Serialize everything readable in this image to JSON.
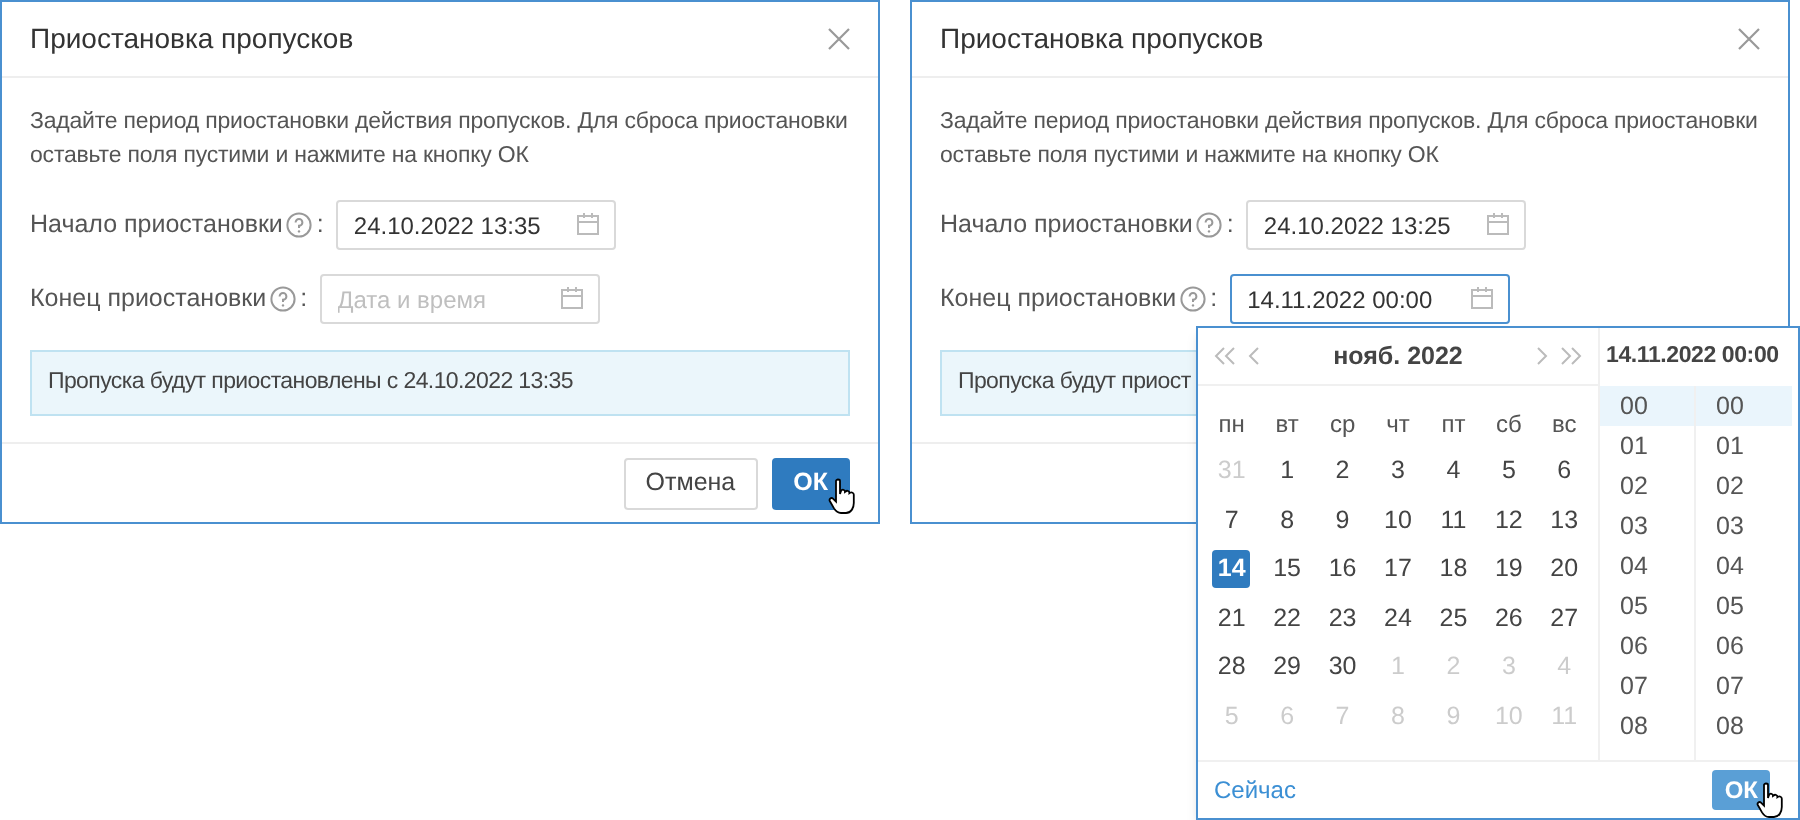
{
  "dialogs": [
    {
      "title": "Приостановка пропусков",
      "description": "Задайте период приостановки действия пропусков. Для сброса приостановки оставьте поля пустими и нажмите на кнопку ОК",
      "fields": [
        {
          "label": "Начало приостановки",
          "suffix": ":",
          "value": "24.10.2022 13:35",
          "focused": false
        },
        {
          "label": "Конец приостановки",
          "suffix": ":",
          "placeholder": "Дата и время",
          "focused": false
        }
      ],
      "info": "Пропуска будут приостановлены с 24.10.2022 13:35",
      "buttons": [
        {
          "label": "Отмена",
          "kind": "secondary"
        },
        {
          "label": "ОК",
          "kind": "primary"
        }
      ]
    },
    {
      "title": "Приостановка пропусков",
      "description": "Задайте период приостановки действия пропусков. Для сброса приостановки оставьте поля пустими и нажмите на кнопку ОК",
      "fields": [
        {
          "label": "Начало приостановки",
          "suffix": ":",
          "value": "24.10.2022 13:25",
          "focused": false
        },
        {
          "label": "Конец приостановки",
          "suffix": ":",
          "value": "14.11.2022 00:00",
          "focused": true
        }
      ],
      "info": "Пропуска будут приост"
    }
  ],
  "picker": {
    "month_label": "нояб. 2022",
    "weekdays": [
      "пн",
      "вт",
      "ср",
      "чт",
      "пт",
      "сб",
      "вс"
    ],
    "days": [
      {
        "label": "31",
        "muted": true,
        "selected": false
      },
      {
        "label": "1",
        "muted": false,
        "selected": false
      },
      {
        "label": "2",
        "muted": false,
        "selected": false
      },
      {
        "label": "3",
        "muted": false,
        "selected": false
      },
      {
        "label": "4",
        "muted": false,
        "selected": false
      },
      {
        "label": "5",
        "muted": false,
        "selected": false
      },
      {
        "label": "6",
        "muted": false,
        "selected": false
      },
      {
        "label": "7",
        "muted": false,
        "selected": false
      },
      {
        "label": "8",
        "muted": false,
        "selected": false
      },
      {
        "label": "9",
        "muted": false,
        "selected": false
      },
      {
        "label": "10",
        "muted": false,
        "selected": false
      },
      {
        "label": "11",
        "muted": false,
        "selected": false
      },
      {
        "label": "12",
        "muted": false,
        "selected": false
      },
      {
        "label": "13",
        "muted": false,
        "selected": false
      },
      {
        "label": "14",
        "muted": false,
        "selected": true
      },
      {
        "label": "15",
        "muted": false,
        "selected": false
      },
      {
        "label": "16",
        "muted": false,
        "selected": false
      },
      {
        "label": "17",
        "muted": false,
        "selected": false
      },
      {
        "label": "18",
        "muted": false,
        "selected": false
      },
      {
        "label": "19",
        "muted": false,
        "selected": false
      },
      {
        "label": "20",
        "muted": false,
        "selected": false
      },
      {
        "label": "21",
        "muted": false,
        "selected": false
      },
      {
        "label": "22",
        "muted": false,
        "selected": false
      },
      {
        "label": "23",
        "muted": false,
        "selected": false
      },
      {
        "label": "24",
        "muted": false,
        "selected": false
      },
      {
        "label": "25",
        "muted": false,
        "selected": false
      },
      {
        "label": "26",
        "muted": false,
        "selected": false
      },
      {
        "label": "27",
        "muted": false,
        "selected": false
      },
      {
        "label": "28",
        "muted": false,
        "selected": false
      },
      {
        "label": "29",
        "muted": false,
        "selected": false
      },
      {
        "label": "30",
        "muted": false,
        "selected": false
      },
      {
        "label": "1",
        "muted": true,
        "selected": false
      },
      {
        "label": "2",
        "muted": true,
        "selected": false
      },
      {
        "label": "3",
        "muted": true,
        "selected": false
      },
      {
        "label": "4",
        "muted": true,
        "selected": false
      },
      {
        "label": "5",
        "muted": true,
        "selected": false
      },
      {
        "label": "6",
        "muted": true,
        "selected": false
      },
      {
        "label": "7",
        "muted": true,
        "selected": false
      },
      {
        "label": "8",
        "muted": true,
        "selected": false
      },
      {
        "label": "9",
        "muted": true,
        "selected": false
      },
      {
        "label": "10",
        "muted": true,
        "selected": false
      },
      {
        "label": "11",
        "muted": true,
        "selected": false
      }
    ],
    "time_header": "14.11.2022 00:00",
    "hours": [
      {
        "label": "00",
        "selected": true
      },
      {
        "label": "01",
        "selected": false
      },
      {
        "label": "02",
        "selected": false
      },
      {
        "label": "03",
        "selected": false
      },
      {
        "label": "04",
        "selected": false
      },
      {
        "label": "05",
        "selected": false
      },
      {
        "label": "06",
        "selected": false
      },
      {
        "label": "07",
        "selected": false
      },
      {
        "label": "08",
        "selected": false
      }
    ],
    "minutes": [
      {
        "label": "00",
        "selected": true
      },
      {
        "label": "01",
        "selected": false
      },
      {
        "label": "02",
        "selected": false
      },
      {
        "label": "03",
        "selected": false
      },
      {
        "label": "04",
        "selected": false
      },
      {
        "label": "05",
        "selected": false
      },
      {
        "label": "06",
        "selected": false
      },
      {
        "label": "07",
        "selected": false
      },
      {
        "label": "08",
        "selected": false
      }
    ],
    "now_link": "Сейчас",
    "ok_label": "ОК"
  }
}
